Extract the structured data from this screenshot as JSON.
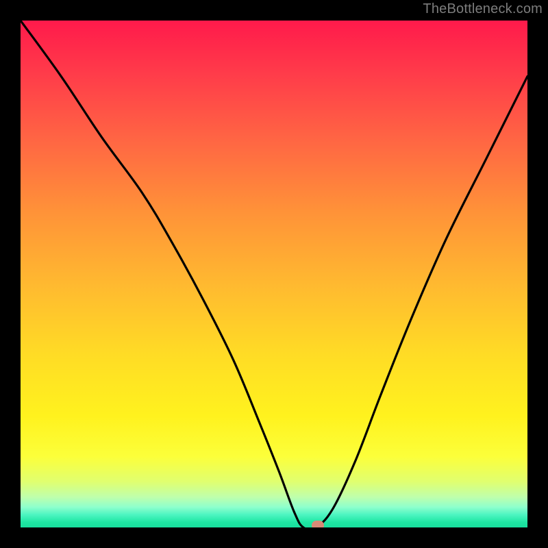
{
  "attribution": "TheBottleneck.com",
  "marker": {
    "color": "#d88a77"
  },
  "chart_data": {
    "type": "line",
    "title": "",
    "xlabel": "",
    "ylabel": "",
    "xlim": [
      0,
      100
    ],
    "ylim": [
      0,
      100
    ],
    "series": [
      {
        "name": "curve",
        "x": [
          0,
          8,
          16,
          24,
          30,
          36,
          42,
          47,
          51,
          54,
          55.8,
          58.2,
          61.5,
          66,
          71,
          77,
          84,
          92,
          100
        ],
        "y": [
          100,
          89,
          77,
          66,
          56,
          45,
          33,
          21,
          11,
          3,
          0,
          0,
          3.5,
          13,
          26,
          41,
          57,
          73,
          89
        ]
      }
    ],
    "marker_point": {
      "x": 58.6,
      "y": 0
    },
    "gradient_stops": [
      {
        "pos": 0,
        "color": "#ff1a4b"
      },
      {
        "pos": 0.1,
        "color": "#ff3a4a"
      },
      {
        "pos": 0.24,
        "color": "#ff6743"
      },
      {
        "pos": 0.38,
        "color": "#ff9338"
      },
      {
        "pos": 0.52,
        "color": "#ffb930"
      },
      {
        "pos": 0.66,
        "color": "#ffdc25"
      },
      {
        "pos": 0.78,
        "color": "#fff21e"
      },
      {
        "pos": 0.86,
        "color": "#fcff3a"
      },
      {
        "pos": 0.91,
        "color": "#e0ff70"
      },
      {
        "pos": 0.94,
        "color": "#bfffac"
      },
      {
        "pos": 0.96,
        "color": "#8dffcd"
      },
      {
        "pos": 0.975,
        "color": "#4cf5c1"
      },
      {
        "pos": 0.99,
        "color": "#1ee6a2"
      },
      {
        "pos": 1.0,
        "color": "#19df9e"
      }
    ]
  }
}
